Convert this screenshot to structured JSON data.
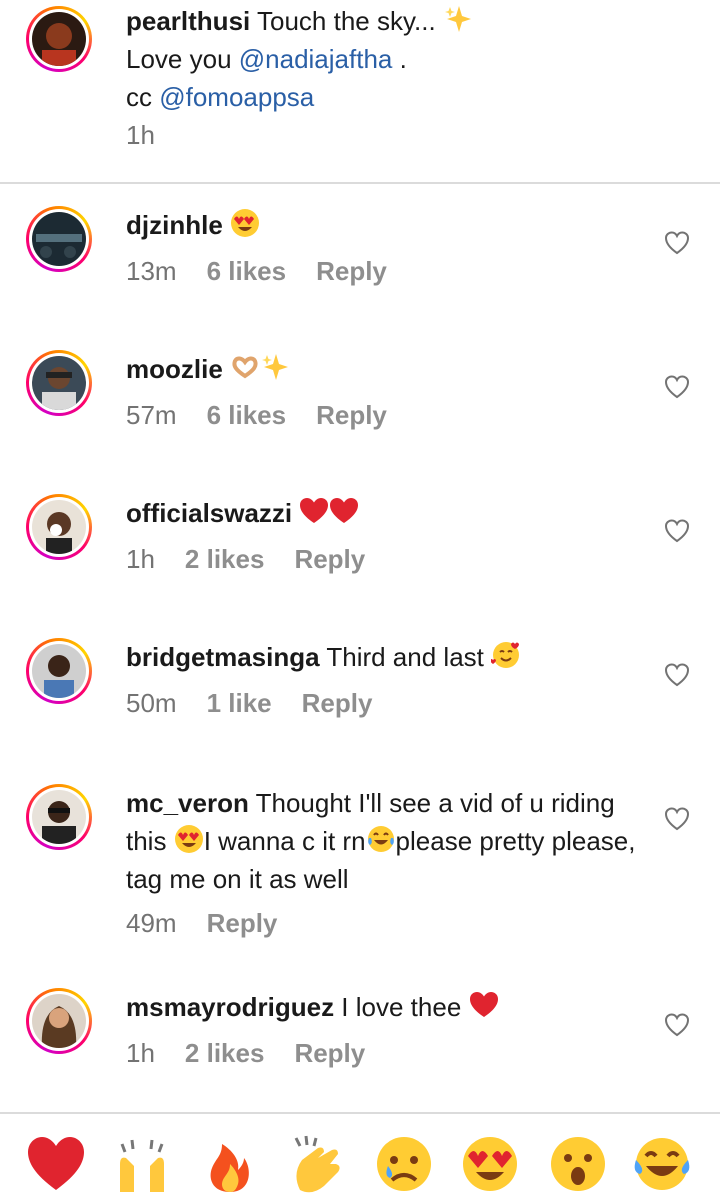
{
  "caption": {
    "username": "pearlthusi",
    "text_1": " Touch the sky... ",
    "emoji": "sparkles",
    "line2_prefix": "Love you ",
    "mention1": "@nadiajaftha",
    "line2_suffix": " .",
    "line3_prefix": "cc ",
    "mention2": "@fomoappsa",
    "time": "1h"
  },
  "comments": [
    {
      "username": "djzinhle",
      "text": "",
      "emojis": [
        "heart-eyes"
      ],
      "time": "13m",
      "likes": "6 likes",
      "reply": "Reply"
    },
    {
      "username": "moozlie",
      "text": "",
      "emojis": [
        "heart-hands",
        "sparkles"
      ],
      "time": "57m",
      "likes": "6 likes",
      "reply": "Reply"
    },
    {
      "username": "officialswazzi",
      "text": "",
      "emojis": [
        "red-heart",
        "red-heart"
      ],
      "time": "1h",
      "likes": "2 likes",
      "reply": "Reply"
    },
    {
      "username": "bridgetmasinga",
      "text": " Third and last ",
      "emojis": [
        "smiling-hearts"
      ],
      "time": "50m",
      "likes": "1 like",
      "reply": "Reply"
    },
    {
      "username": "mc_veron",
      "text_a": " Thought I'll see a vid of u riding this ",
      "text_b": "I wanna c it rn",
      "text_c": "please pretty please, tag me on it as well",
      "time": "49m",
      "likes": "",
      "reply": "Reply"
    },
    {
      "username": "msmayrodriguez",
      "text": " I love thee ",
      "emojis": [
        "red-heart"
      ],
      "time": "1h",
      "likes": "2 likes",
      "reply": "Reply"
    }
  ],
  "emoji_bar": [
    "red-heart",
    "raising-hands",
    "fire",
    "clapping-hands",
    "sad-tear",
    "heart-eyes",
    "surprised",
    "tears-of-joy"
  ],
  "colors": {
    "mention": "#2a5fa6",
    "meta": "#737373",
    "divider": "#dbdbdb",
    "heart": "#e0242f"
  }
}
